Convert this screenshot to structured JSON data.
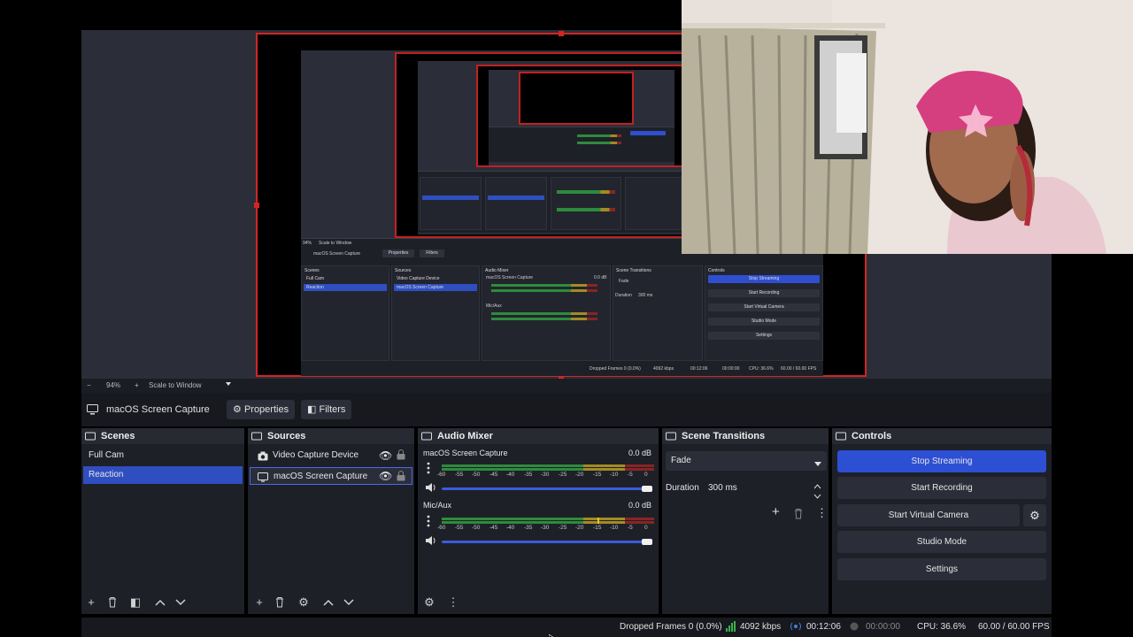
{
  "zoom": {
    "minus": "−",
    "level": "94%",
    "plus": "+",
    "scale_mode": "Scale to Window",
    "dropdown_icon": "caret-down-icon"
  },
  "source_toolbar": {
    "selected_source": "macOS Screen Capture",
    "properties_label": "Properties",
    "filters_label": "Filters"
  },
  "scenes": {
    "title": "Scenes",
    "items": [
      "Full Cam",
      "Reaction"
    ],
    "selected": "Reaction"
  },
  "sources": {
    "title": "Sources",
    "items": [
      "Video Capture Device",
      "macOS Screen Capture"
    ]
  },
  "audio_mixer": {
    "title": "Audio Mixer",
    "channels": [
      {
        "name": "macOS Screen Capture",
        "level": "0.0 dB"
      },
      {
        "name": "Mic/Aux",
        "level": "0.0 dB"
      }
    ],
    "scale": [
      "-60",
      "-55",
      "-50",
      "-45",
      "-40",
      "-35",
      "-30",
      "-25",
      "-20",
      "-15",
      "-10",
      "-5",
      "0"
    ]
  },
  "transitions": {
    "title": "Scene Transitions",
    "selected": "Fade",
    "duration_label": "Duration",
    "duration_value": "300 ms"
  },
  "controls": {
    "title": "Controls",
    "stop_streaming": "Stop Streaming",
    "start_recording": "Start Recording",
    "start_virtual_camera": "Start Virtual Camera",
    "studio_mode": "Studio Mode",
    "settings": "Settings"
  },
  "status": {
    "dropped_frames": "Dropped Frames 0 (0.0%)",
    "bitrate": "4092 kbps",
    "stream_time": "00:12:06",
    "record_time": "00:00:00",
    "cpu": "CPU: 36.6%",
    "fps": "60.00 / 60.00 FPS"
  },
  "nested_preview": {
    "source_name": "macOS Screen Capture",
    "properties": "Properties",
    "filters": "Filters",
    "scenes": "Scenes",
    "sources": "Sources",
    "audio_mixer": "Audio Mixer",
    "scene_transitions": "Scene Transitions",
    "controls": "Controls",
    "scene_items": [
      "Full Cam",
      "Reaction"
    ],
    "source_items": [
      "Video Capture Device",
      "macOS Screen Capture"
    ],
    "mixer_channel_1": "macOS Screen Capture",
    "mixer_channel_2": "Mic/Aux",
    "mixer_level": "0.0 dB",
    "transition": "Fade",
    "duration_label": "Duration",
    "duration": "300 ms",
    "buttons": [
      "Stop Streaming",
      "Start Recording",
      "Start Virtual Camera",
      "Studio Mode",
      "Settings"
    ],
    "zoom_level": "94%",
    "scale_mode": "Scale to Window",
    "status": {
      "dropped_frames": "Dropped Frames 0 (0.0%)",
      "bitrate": "4092 kbps",
      "stream_time": "00:12:06",
      "record_time": "00:00:00",
      "cpu": "CPU: 36.6%",
      "fps": "60.00 / 60.00 FPS"
    }
  },
  "colors": {
    "accent": "#2d4fd4",
    "selection": "#2f4fc0",
    "preview_border": "#d42424",
    "meter_green": "#2e8b3c",
    "meter_yellow": "#a38b23",
    "meter_red": "#8a2424"
  }
}
